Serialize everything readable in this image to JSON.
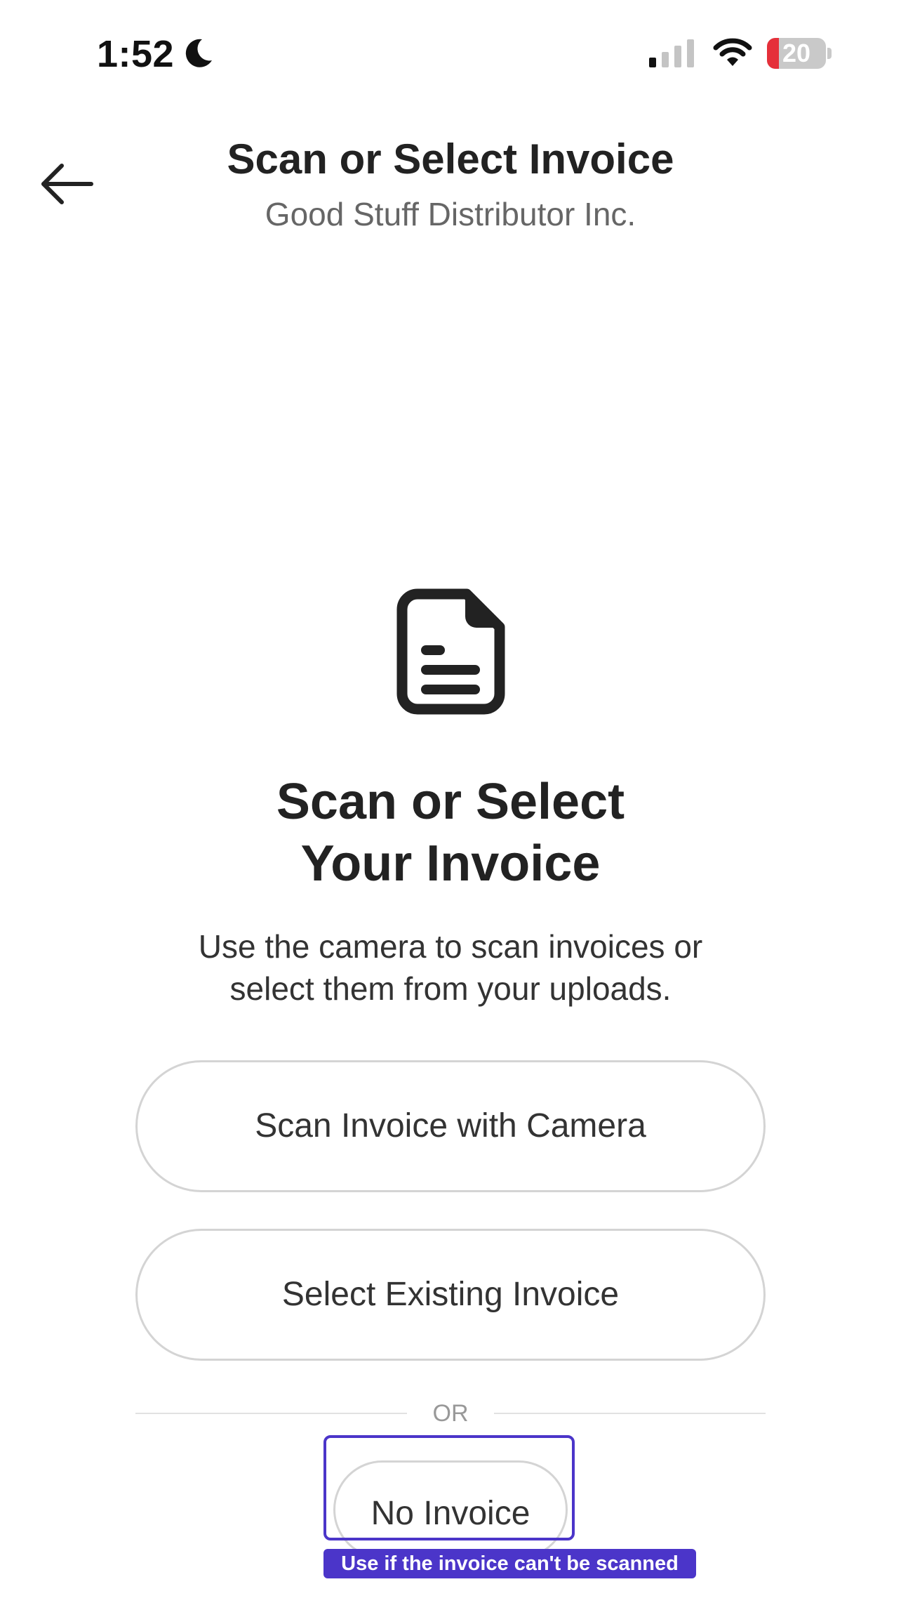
{
  "status_bar": {
    "time": "1:52",
    "moon_icon": "moon-icon",
    "signal_icon": "cellular-signal-icon",
    "wifi_icon": "wifi-icon",
    "battery_level": "20",
    "battery_fraction": 0.2,
    "battery_color": "#e5303a"
  },
  "header": {
    "back_icon": "arrow-left-icon",
    "title": "Scan or Select Invoice",
    "subtitle": "Good Stuff Distributor Inc."
  },
  "main": {
    "icon": "document-icon",
    "heading_line1": "Scan or Select",
    "heading_line2": "Your Invoice",
    "description_line1": "Use the camera to scan invoices or",
    "description_line2": "select them from your uploads.",
    "scan_button_label": "Scan Invoice with Camera",
    "select_button_label": "Select Existing Invoice",
    "or_label": "OR",
    "no_invoice_label": "No Invoice",
    "tooltip": "Use if the invoice can't be scanned",
    "accent_color": "#4b35c9"
  }
}
